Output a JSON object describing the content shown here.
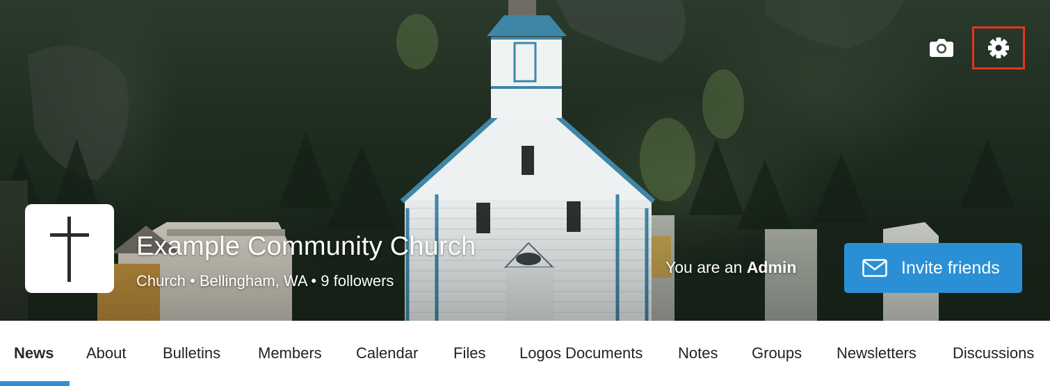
{
  "hero": {
    "title": "Example Community Church",
    "meta": "Church • Bellingham, WA • 9 followers",
    "role_prefix": "You are an ",
    "role_value": "Admin",
    "invite_label": "Invite friends",
    "icons": {
      "camera": "camera-icon",
      "settings": "gear-icon",
      "avatar": "cross-icon",
      "invite": "envelope-icon"
    },
    "colors": {
      "accent": "#2b8fd6",
      "settings_highlight": "#e8321f"
    }
  },
  "tabs": [
    {
      "label": "News",
      "active": true
    },
    {
      "label": "About"
    },
    {
      "label": "Bulletins"
    },
    {
      "label": "Members"
    },
    {
      "label": "Calendar"
    },
    {
      "label": "Files"
    },
    {
      "label": "Logos Documents"
    },
    {
      "label": "Notes"
    },
    {
      "label": "Groups"
    },
    {
      "label": "Newsletters"
    },
    {
      "label": "Discussions"
    }
  ]
}
